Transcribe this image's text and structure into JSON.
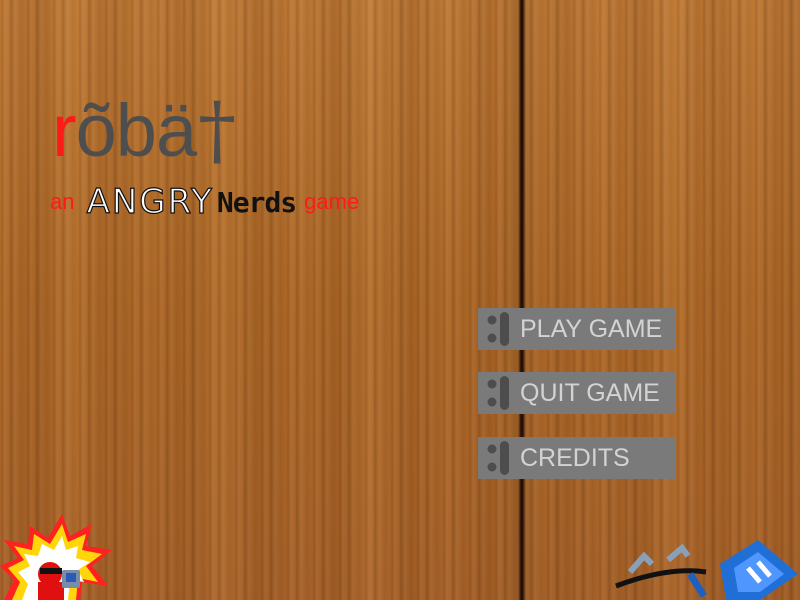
{
  "title": {
    "first_letter": "r",
    "rest": "õbä",
    "cross": "†"
  },
  "subtitle": {
    "prefix": "an",
    "studio_angry": "ANGRY",
    "studio_nerds": "Nerds",
    "suffix": "game"
  },
  "menu": {
    "items": [
      {
        "label": "PLAY GAME"
      },
      {
        "label": "QUIT GAME"
      },
      {
        "label": "CREDITS"
      }
    ]
  },
  "colors": {
    "title_accent": "#ff1a1a",
    "title_main": "#4e4e4e",
    "button_bg": "#7a7a7a",
    "button_text": "#d3d3d3",
    "wood": "#b8722e"
  },
  "icons": {
    "left_corner": "angry-nerd-explosion-logo",
    "right_corner": "blue-badge-logo",
    "button_hinge": "hinge-icon"
  }
}
